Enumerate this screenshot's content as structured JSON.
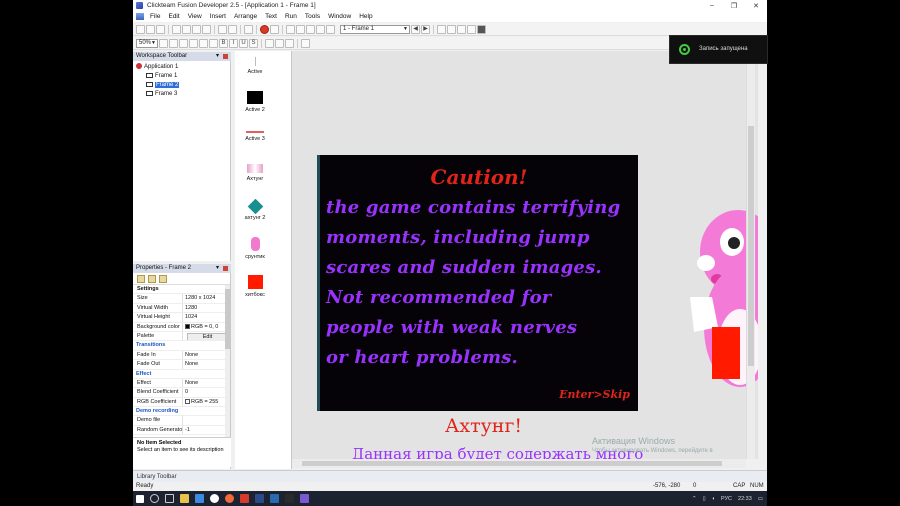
{
  "window": {
    "title": "Clickteam Fusion Developer 2.5 - [Application 1 - Frame 1]",
    "controls": [
      "–",
      "❐",
      "✕"
    ]
  },
  "menu": [
    "File",
    "Edit",
    "View",
    "Insert",
    "Arrange",
    "Text",
    "Run",
    "Tools",
    "Window",
    "Help"
  ],
  "toolbar": {
    "frame_combo": "1 - Frame 1",
    "zoom": "50%"
  },
  "workspace": {
    "header": "Workspace Toolbar",
    "app": "Application 1",
    "frames": [
      "Frame 1",
      "Frame 2",
      "Frame 3"
    ],
    "selected": "Frame 2"
  },
  "properties": {
    "header": "Properties - Frame 2",
    "rows": [
      {
        "k": "Settings",
        "type": "head"
      },
      {
        "k": "Size",
        "v": "1280 x 1024"
      },
      {
        "k": "Virtual Width",
        "v": "1280"
      },
      {
        "k": "Virtual Height",
        "v": "1024"
      },
      {
        "k": "Background color",
        "v": "RGB = 0, 0",
        "swatch": "#000000"
      },
      {
        "k": "Palette",
        "v": "Edit",
        "button": true
      },
      {
        "k": "Transitions",
        "type": "group"
      },
      {
        "k": "Fade In",
        "v": "None"
      },
      {
        "k": "Fade Out",
        "v": "None"
      },
      {
        "k": "Effect",
        "type": "group"
      },
      {
        "k": "Effect",
        "v": "None"
      },
      {
        "k": "Blend Coefficient",
        "v": "0"
      },
      {
        "k": "RGB Coefficient",
        "v": "RGB = 255",
        "swatch": "#ffffff"
      },
      {
        "k": "Demo recording",
        "type": "group"
      },
      {
        "k": "Demo file",
        "v": ""
      },
      {
        "k": "Random Generator",
        "v": "-1"
      }
    ],
    "no_item_title": "No Item Selected",
    "no_item_hint": "Select an item to see its description"
  },
  "objects": [
    "Active",
    "Active 2",
    "Active 3",
    "Ахтунг",
    "ахтунг 2",
    "срунтик",
    "хитбокс"
  ],
  "canvas": {
    "caution": "Caution!",
    "lines": [
      "the game contains terrifying",
      "moments, including jump",
      "scares and sudden images.",
      "Not recommended for",
      " people with weak nerves",
      " or heart problems."
    ],
    "skip": "Enter>Skip",
    "ahtung": "Ахтунг!",
    "ru_text": "Данная игра будет содержать много",
    "activation_title": "Активация Windows",
    "activation_sub": "Чтобы активировать Windows, перейдите в"
  },
  "library_bar": "Library Toolbar",
  "status": {
    "left": "Ready",
    "coords": "-576, -280",
    "zero": "0",
    "cap": "CAP",
    "num": "NUM"
  },
  "taskbar": {
    "lang": "РУС",
    "time": "22:33"
  },
  "recording_notice": "Запись запущена"
}
